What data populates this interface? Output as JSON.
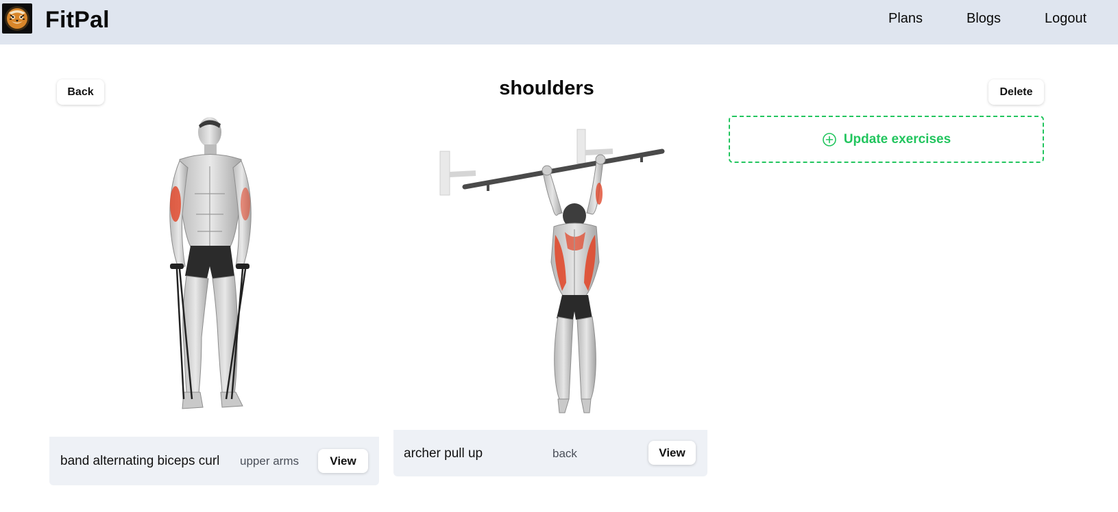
{
  "app": {
    "name": "FitPal",
    "logo_icon": "tiger-logo-icon"
  },
  "nav": {
    "items": [
      {
        "label": "Plans"
      },
      {
        "label": "Blogs"
      },
      {
        "label": "Logout"
      }
    ]
  },
  "page": {
    "title": "shoulders",
    "back_label": "Back",
    "delete_label": "Delete"
  },
  "exercises": [
    {
      "name": "band alternating biceps curl",
      "body_part": "upper arms",
      "view_label": "View",
      "image": "band-biceps-curl-illustration"
    },
    {
      "name": "archer pull up",
      "body_part": "back",
      "view_label": "View",
      "image": "archer-pull-up-illustration"
    }
  ],
  "update_exercises": {
    "label": "Update exercises",
    "icon": "plus-circle-icon"
  },
  "colors": {
    "header_bg": "#dfe5ef",
    "accent_green": "#22c55e",
    "card_footer_bg": "#eef1f6",
    "muscle_highlight": "#e04a2e"
  }
}
